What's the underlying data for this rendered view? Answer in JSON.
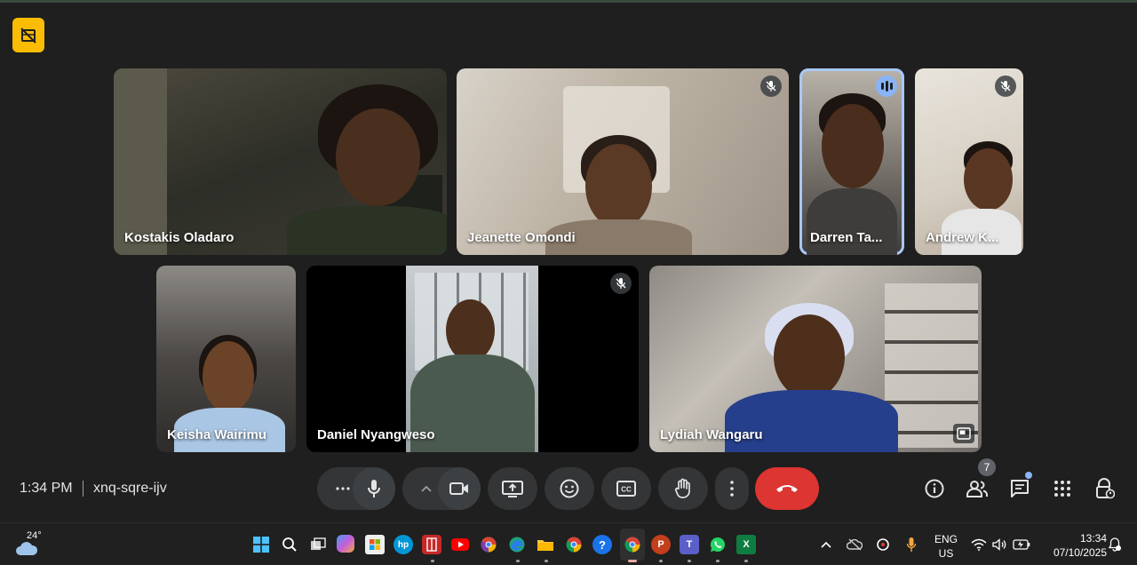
{
  "meeting": {
    "time": "1:34 PM",
    "code": "xnq-sqre-ijv",
    "participant_count": "7"
  },
  "participants": [
    {
      "name": "Kostakis Oladaro",
      "muted": false,
      "speaking": false
    },
    {
      "name": "Jeanette Omondi",
      "muted": true,
      "speaking": false
    },
    {
      "name": "Darren Ta...",
      "muted": false,
      "speaking": true
    },
    {
      "name": "Andrew K...",
      "muted": true,
      "speaking": false
    },
    {
      "name": "Keisha Wairimu",
      "muted": false,
      "speaking": false
    },
    {
      "name": "Daniel Nyangweso",
      "muted": true,
      "speaking": false
    },
    {
      "name": "Lydiah Wangaru",
      "muted": false,
      "speaking": false
    }
  ],
  "controls": [
    "more-options",
    "microphone",
    "camera-options",
    "camera",
    "present-screen",
    "reactions",
    "captions",
    "raise-hand",
    "overflow-menu",
    "leave-call"
  ],
  "side_controls": [
    "meeting-info",
    "people",
    "chat",
    "activities",
    "host-controls"
  ],
  "taskbar": {
    "weather_temp": "24°",
    "language_line1": "ENG",
    "language_line2": "US",
    "clock_time": "13:34",
    "clock_date": "07/10/2025"
  },
  "colors": {
    "background": "#1f1f1f",
    "recording_badge": "#fbbc04",
    "speaking_outline": "#a8c7fa",
    "end_call": "#dc3532",
    "control_bg": "#333537"
  }
}
